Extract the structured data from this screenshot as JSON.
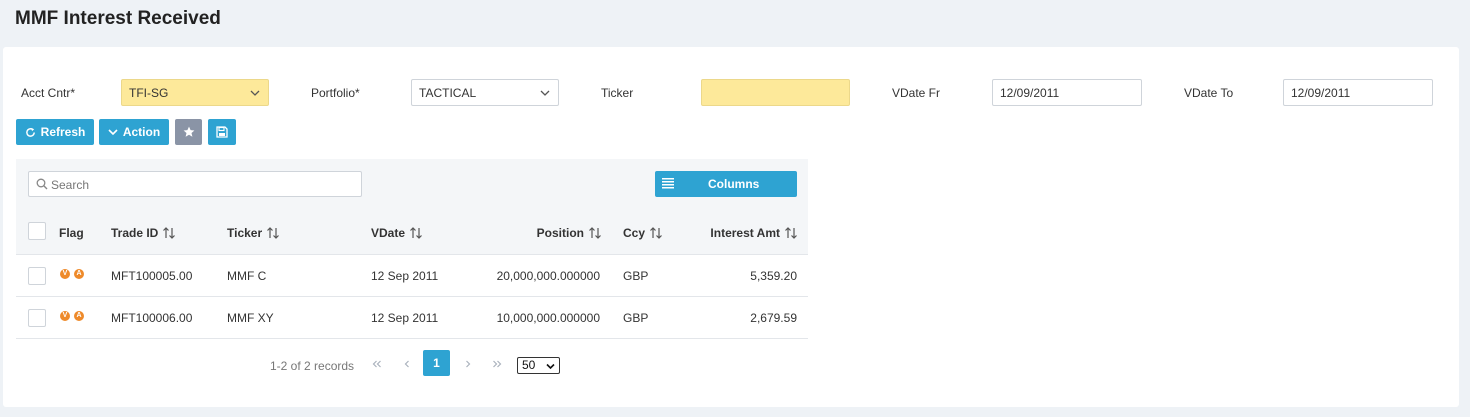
{
  "page": {
    "title": "MMF Interest Received"
  },
  "filters": {
    "acct_cntr": {
      "label": "Acct Cntr*",
      "value": "TFI-SG"
    },
    "portfolio": {
      "label": "Portfolio*",
      "value": "TACTICAL"
    },
    "ticker": {
      "label": "Ticker",
      "value": ""
    },
    "vdate_fr": {
      "label": "VDate Fr",
      "value": "12/09/2011"
    },
    "vdate_to": {
      "label": "VDate To",
      "value": "12/09/2011"
    }
  },
  "toolbar": {
    "refresh_label": "Refresh",
    "action_label": "Action",
    "favorite_icon": "star-icon",
    "save_icon": "floppy-disk-icon"
  },
  "grid": {
    "search_placeholder": "Search",
    "columns_label": "Columns",
    "headers": {
      "flag": "Flag",
      "trade_id": "Trade ID",
      "ticker": "Ticker",
      "vdate": "VDate",
      "position": "Position",
      "ccy": "Ccy",
      "interest_amt": "Interest Amt"
    },
    "rows": [
      {
        "flags": [
          "V",
          "A"
        ],
        "trade_id": "MFT100005.00",
        "ticker": "MMF C",
        "vdate": "12 Sep 2011",
        "position": "20,000,000.000000",
        "ccy": "GBP",
        "interest_amt": "5,359.20"
      },
      {
        "flags": [
          "V",
          "A"
        ],
        "trade_id": "MFT100006.00",
        "ticker": "MMF XY",
        "vdate": "12 Sep 2011",
        "position": "10,000,000.000000",
        "ccy": "GBP",
        "interest_amt": "2,679.59"
      }
    ]
  },
  "pagination": {
    "records_text": "1-2 of 2 records",
    "current_page": "1",
    "page_size": "50"
  },
  "colors": {
    "accent": "#2ea3d2",
    "required_field": "#fde99a",
    "flag_badge": "#ee8a2a"
  }
}
